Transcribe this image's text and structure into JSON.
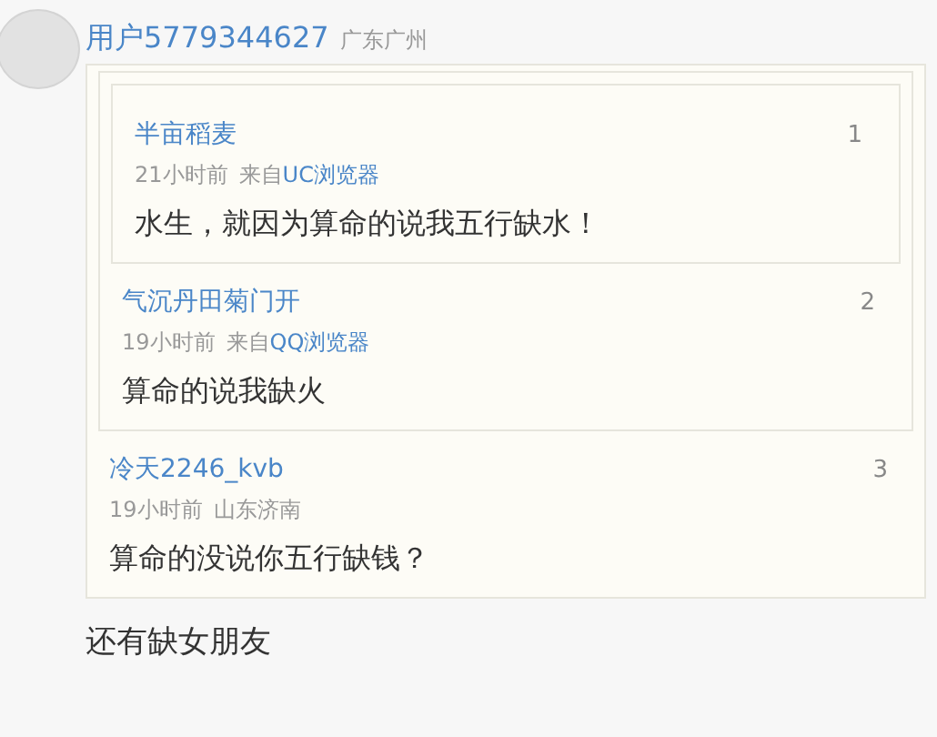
{
  "comment": {
    "user": "用户5779344627",
    "location": "广东广州",
    "quote": {
      "user": "冷天2246_kvb",
      "floor": "3",
      "meta": [
        {
          "kind": "text",
          "text": "19小时前"
        },
        {
          "kind": "text",
          "text": "山东济南"
        }
      ],
      "text": "算命的没说你五行缺钱？",
      "quote": {
        "user": "气沉丹田菊门开",
        "floor": "2",
        "meta": [
          {
            "kind": "text",
            "text": "19小时前"
          },
          {
            "kind": "text",
            "text": "来自"
          },
          {
            "kind": "link",
            "text": "QQ浏览器"
          }
        ],
        "text": "算命的说我缺火",
        "quote": {
          "user": "半亩稻麦",
          "floor": "1",
          "meta": [
            {
              "kind": "text",
              "text": "21小时前"
            },
            {
              "kind": "text",
              "text": "来自"
            },
            {
              "kind": "link",
              "text": "UC浏览器"
            }
          ],
          "text": "水生，就因为算命的说我五行缺水！"
        }
      }
    },
    "text": "还有缺女朋友"
  }
}
